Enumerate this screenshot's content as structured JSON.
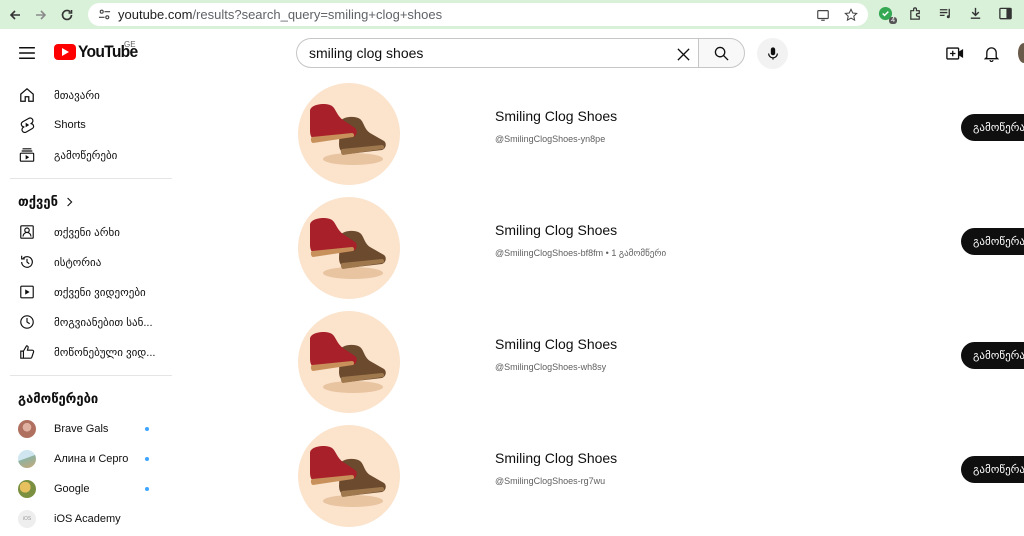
{
  "browser": {
    "url_host": "youtube.com",
    "url_rest": "/results?search_query=smiling+clog+shoes",
    "extension_badge": "4"
  },
  "header": {
    "logo_text": "YouTube",
    "region": "GE",
    "search_value": "smiling clog shoes"
  },
  "sidebar": {
    "main": [
      {
        "label": "მთავარი",
        "icon": "home-icon"
      },
      {
        "label": "Shorts",
        "icon": "shorts-icon"
      },
      {
        "label": "გამოწერები",
        "icon": "subscriptions-icon"
      }
    ],
    "you_heading": "თქვენ",
    "you_items": [
      {
        "label": "თქვენი არხი",
        "icon": "your-channel-icon"
      },
      {
        "label": "ისტორია",
        "icon": "history-icon"
      },
      {
        "label": "თქვენი ვიდეოები",
        "icon": "your-videos-icon"
      },
      {
        "label": "მოგვიანებით სან...",
        "icon": "watch-later-icon"
      },
      {
        "label": "მოწონებული ვიდ...",
        "icon": "liked-icon"
      }
    ],
    "subs_heading": "გამოწერები",
    "subscriptions": [
      {
        "label": "Brave Gals",
        "dot": true,
        "color": "#b07060"
      },
      {
        "label": "Алина и Серго",
        "dot": true,
        "color": "#8fb3a0"
      },
      {
        "label": "Google",
        "dot": true,
        "color": "#c9a040"
      },
      {
        "label": "iOS Academy",
        "dot": false,
        "color": "#e8e8e8"
      }
    ]
  },
  "results": [
    {
      "name": "Smiling Clog Shoes",
      "meta": "@SmilingClogShoes-yn8pe",
      "subscribe": "გამოწერა"
    },
    {
      "name": "Smiling Clog Shoes",
      "meta": "@SmilingClogShoes-bf8fm • 1 გამომწერი",
      "subscribe": "გამოწერა"
    },
    {
      "name": "Smiling Clog Shoes",
      "meta": "@SmilingClogShoes-wh8sy",
      "subscribe": "გამოწერა"
    },
    {
      "name": "Smiling Clog Shoes",
      "meta": "@SmilingClogShoes-rg7wu",
      "subscribe": "გამოწერა"
    }
  ],
  "colors": {
    "chrome_bg": "#d9f0d9",
    "thumb_bg": "#fbe3cc",
    "clog_red": "#a8202a",
    "clog_brown": "#6b4a2e"
  }
}
